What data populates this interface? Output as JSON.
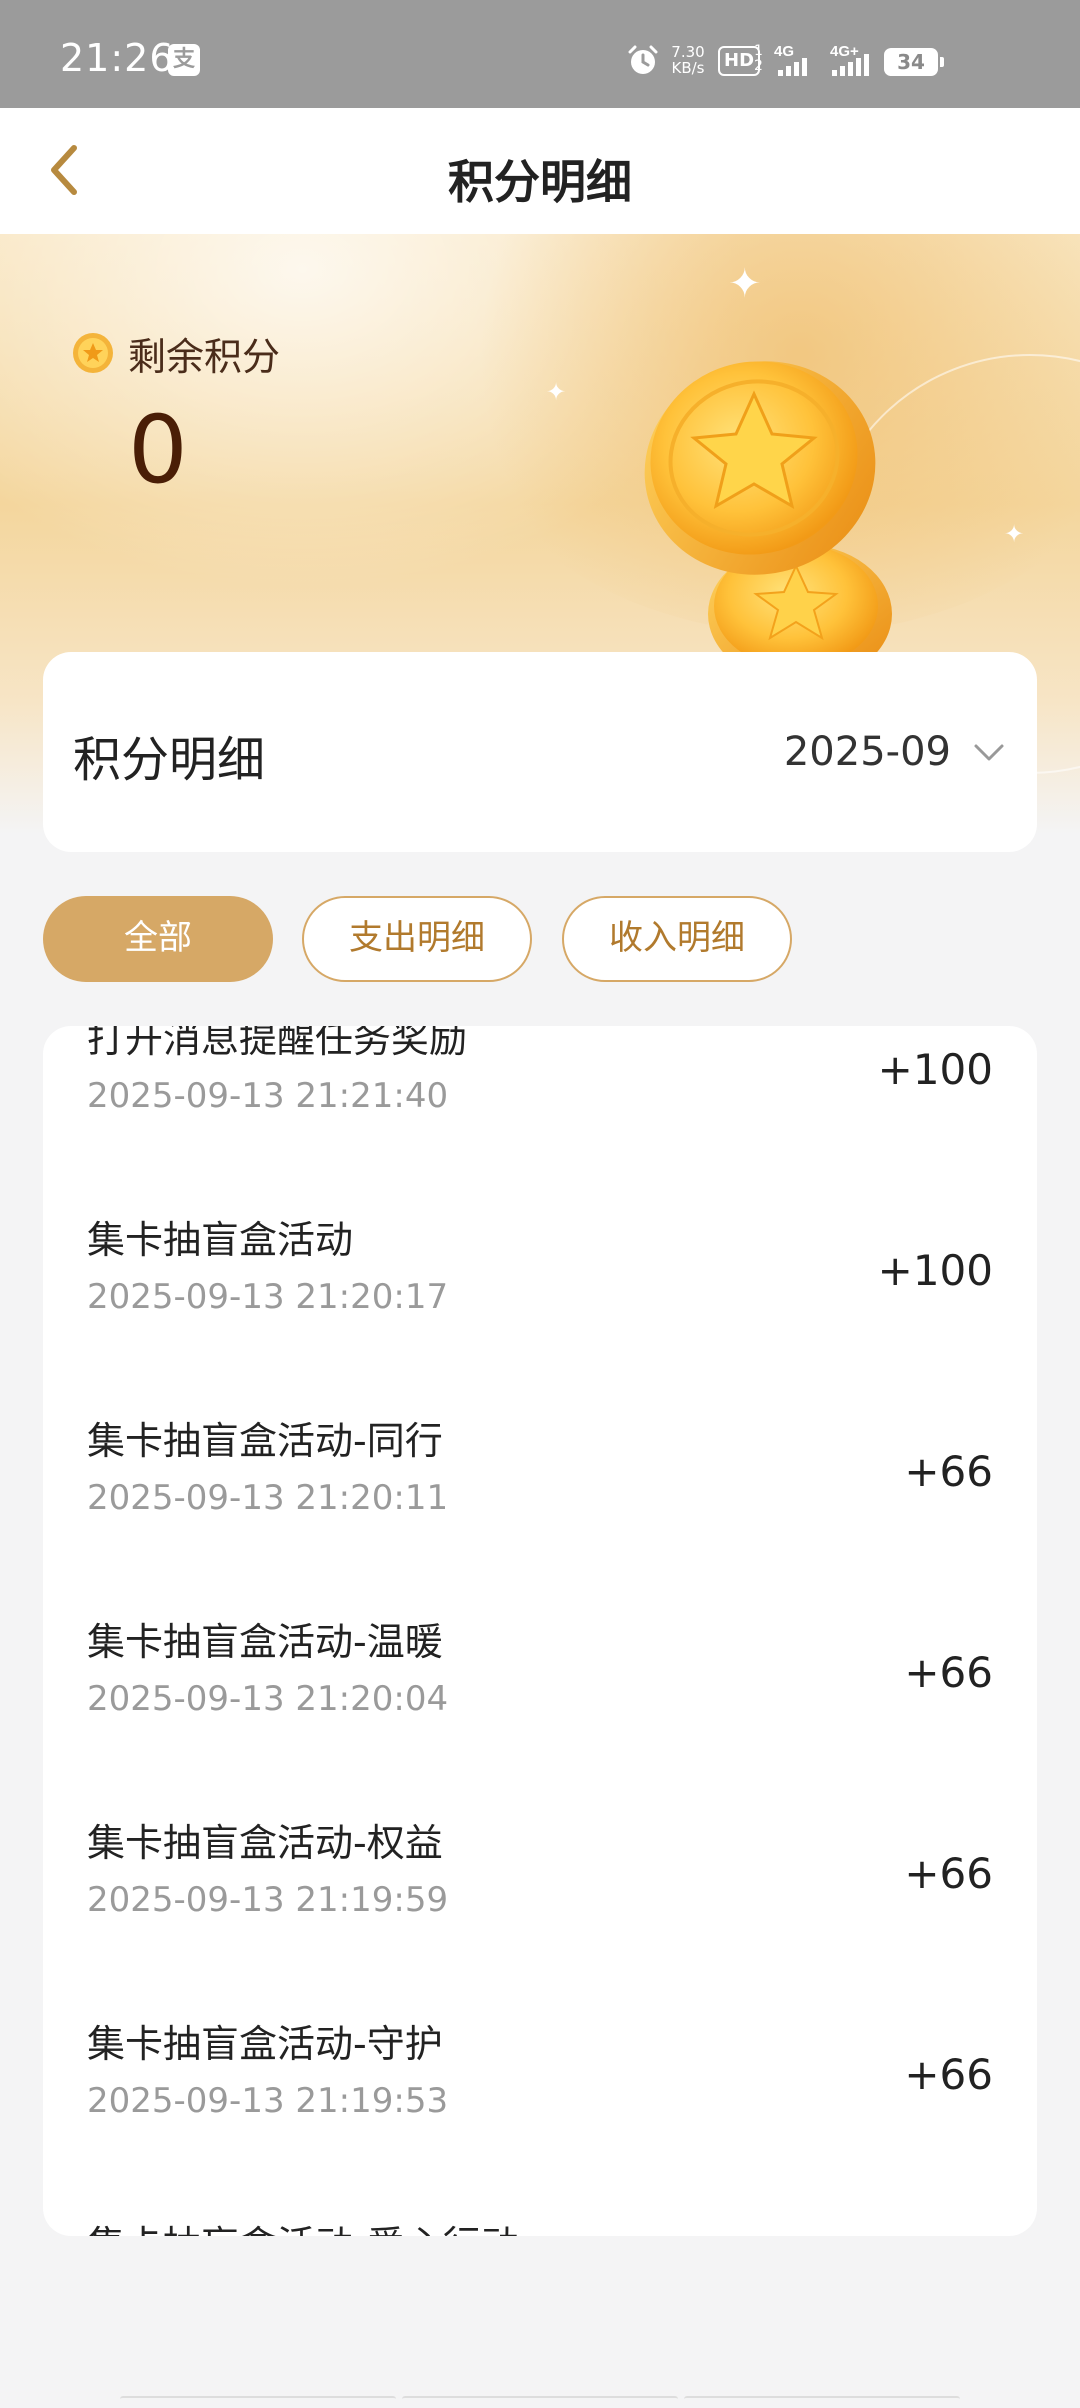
{
  "status_bar": {
    "time": "21:26",
    "app_badge": "支",
    "net_speed_value": "7.30",
    "net_speed_unit": "KB/s",
    "hd_label": "HD",
    "hd_sub_1": "1",
    "hd_sub_2": "2",
    "sim1_label": "4G",
    "sim2_label": "4G+",
    "battery": "34"
  },
  "nav": {
    "title": "积分明细",
    "back_icon": "chevron-left-icon"
  },
  "hero": {
    "label": "剩余积分",
    "points": "0"
  },
  "filter": {
    "title": "积分明细",
    "month": "2025-09"
  },
  "tabs": [
    {
      "label": "全部",
      "active": true
    },
    {
      "label": "支出明细",
      "active": false
    },
    {
      "label": "收入明细",
      "active": false
    }
  ],
  "records": [
    {
      "title": "打开消息提醒任务奖励",
      "time": "2025-09-13 21:21:40",
      "amount": "+100"
    },
    {
      "title": "集卡抽盲盒活动",
      "time": "2025-09-13 21:20:17",
      "amount": "+100"
    },
    {
      "title": "集卡抽盲盒活动-同行",
      "time": "2025-09-13 21:20:11",
      "amount": "+66"
    },
    {
      "title": "集卡抽盲盒活动-温暖",
      "time": "2025-09-13 21:20:04",
      "amount": "+66"
    },
    {
      "title": "集卡抽盲盒活动-权益",
      "time": "2025-09-13 21:19:59",
      "amount": "+66"
    },
    {
      "title": "集卡抽盲盒活动-守护",
      "time": "2025-09-13 21:19:53",
      "amount": "+66"
    },
    {
      "title": "集卡抽盲盒活动-爱心行动",
      "time": "",
      "amount": ""
    }
  ],
  "colors": {
    "accent": "#d6a866",
    "accent_text": "#b17a2d",
    "points_value": "#4a1e06"
  }
}
